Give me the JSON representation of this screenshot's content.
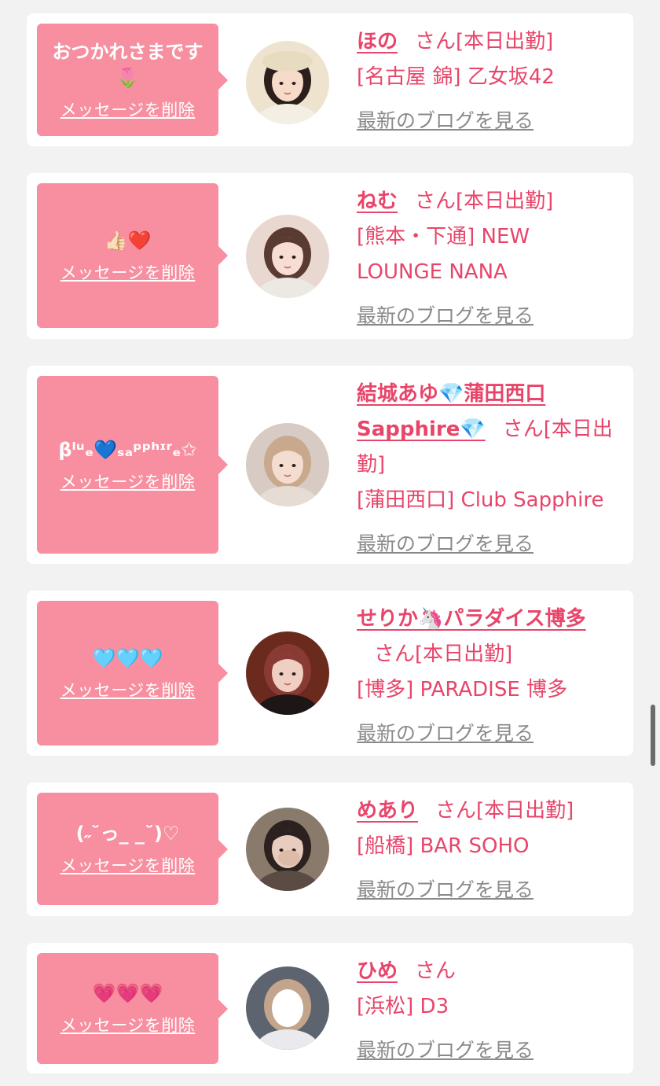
{
  "delete_label": "メッセージを削除",
  "blog_label": "最新のブログを見る",
  "san_suffix": "さん",
  "colors": {
    "page_bg": "#f2f2f2",
    "card_bg": "#ffffff",
    "bubble_bg": "#f78fa0",
    "accent": "#e8456a",
    "link_gray": "#8a8a8a"
  },
  "cards": [
    {
      "message": "おつかれさまです\n🌷",
      "name": "ほの",
      "status": "[本日出勤]",
      "shop": "[名古屋 錦] 乙女坂42",
      "avatar_icon": "girl-cream-beret-avatar"
    },
    {
      "message": "👍🏻❤️",
      "name": "ねむ",
      "status": "[本日出勤]",
      "shop": "[熊本・下通] NEW LOUNGE NANA",
      "avatar_icon": "girl-bangs-avatar"
    },
    {
      "message": "βˡᵘₑ💙ₛₐᵖᵖʰᶦʳₑ✩",
      "name": "結城あゆ💎蒲田西口Sapphire💎",
      "status": "[本日出勤]",
      "shop": "[蒲田西口] Club Sapphire",
      "avatar_icon": "girl-kimono-avatar"
    },
    {
      "message": "🩵🩵🩵",
      "name": "せりか🦄パラダイス博多",
      "status": "[本日出勤]",
      "shop": "[博多] PARADISE 博多",
      "avatar_icon": "girl-red-hair-avatar"
    },
    {
      "message": "(˶˘っ_ _˘)♡",
      "name": "めあり",
      "status": "[本日出勤]",
      "shop": "[船橋] BAR SOHO",
      "avatar_icon": "girl-hand-face-avatar"
    },
    {
      "message": "💗💗💗",
      "name": "ひめ",
      "status": "",
      "shop": "[浜松] D3",
      "avatar_icon": "girl-blurred-face-avatar"
    }
  ]
}
